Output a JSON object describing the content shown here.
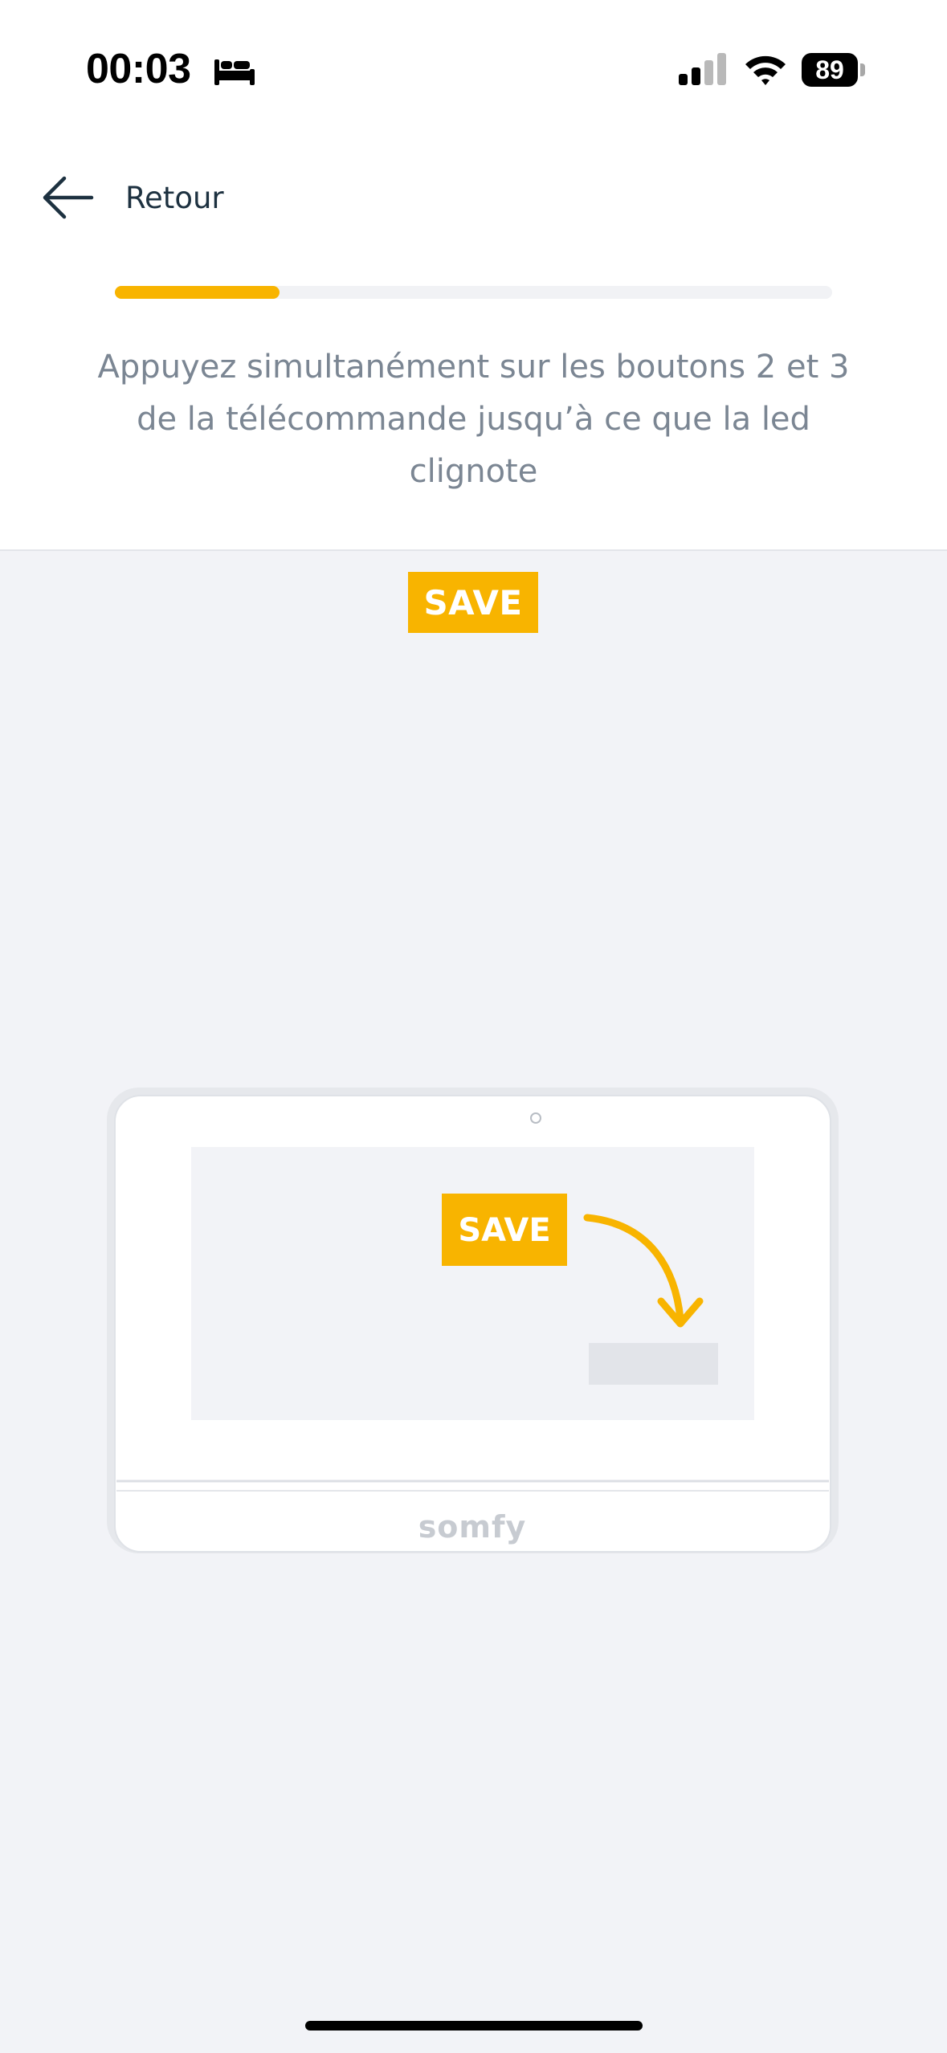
{
  "status_bar": {
    "time": "00:03",
    "battery": "89",
    "icons": [
      "bed-icon",
      "cellular-signal-icon",
      "wifi-icon",
      "battery-icon"
    ]
  },
  "nav": {
    "back_label": "Retour",
    "back_icon": "arrow-left-icon"
  },
  "progress": {
    "value": 0.23,
    "color": "#f8b400"
  },
  "instruction": "Appuyez simultanément sur les boutons 2 et 3 de la télécommande jusqu’à ce que la led clignote",
  "badge": {
    "label": "SAVE"
  },
  "illustration": {
    "screen_badge": "SAVE",
    "brand": "somfy"
  },
  "colors": {
    "accent": "#f8b400",
    "text_dark": "#1d3140",
    "text_muted": "#7b8693",
    "background": "#f2f3f7"
  }
}
